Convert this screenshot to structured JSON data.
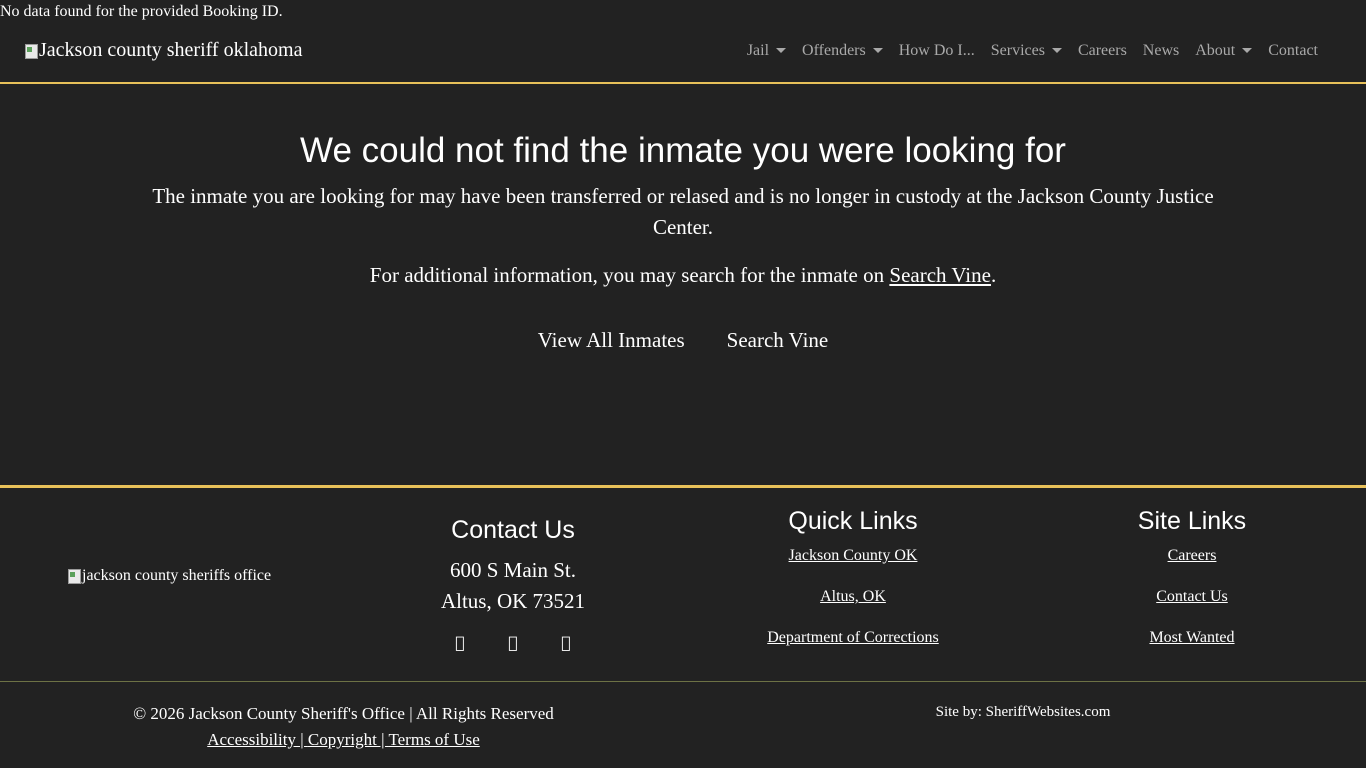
{
  "notice": "No data found for the provided Booking ID.",
  "header": {
    "brand_alt": "Jackson county sheriff oklahoma",
    "nav": [
      {
        "label": "Jail",
        "dropdown": true
      },
      {
        "label": "Offenders",
        "dropdown": true
      },
      {
        "label": "How Do I...",
        "dropdown": false
      },
      {
        "label": "Services",
        "dropdown": true
      },
      {
        "label": "Careers",
        "dropdown": false
      },
      {
        "label": "News",
        "dropdown": false
      },
      {
        "label": "About",
        "dropdown": true
      },
      {
        "label": "Contact",
        "dropdown": false
      }
    ]
  },
  "main": {
    "heading": "We could not find the inmate you were looking for",
    "lead": "The inmate you are looking for may have been transferred or relased and is no longer in custody at the Jackson County Justice Center.",
    "info_prefix": "For additional information, you may search for the inmate on ",
    "info_link": "Search Vine",
    "info_suffix": ".",
    "buttons": {
      "view_all": "View All Inmates",
      "search_vine": "Search Vine"
    }
  },
  "footer": {
    "logo_alt": "jackson county sheriffs office",
    "contact": {
      "title": "Contact Us",
      "address_line1": "600 S Main St.",
      "address_line2": "Altus, OK 73521",
      "social": [
        "facebook-icon",
        "twitter-icon",
        "instagram-icon"
      ]
    },
    "quick_links": {
      "title": "Quick Links",
      "links": [
        "Jackson County OK",
        "Altus, OK",
        "Department of Corrections"
      ]
    },
    "site_links": {
      "title": "Site Links",
      "links": [
        "Careers",
        "Contact Us",
        "Most Wanted"
      ]
    },
    "copyright": "© 2026 Jackson County Sheriff's Office | All Rights Reserved",
    "legal": {
      "accessibility": "Accessibility | ",
      "copyright": "Copyright | ",
      "terms": "Terms of Use"
    },
    "site_by": "Site by: SheriffWebsites.com"
  },
  "colors": {
    "background": "#222222",
    "accent": "#e8c15a",
    "nav_text": "#a9a9a9",
    "text": "#ffffff"
  }
}
